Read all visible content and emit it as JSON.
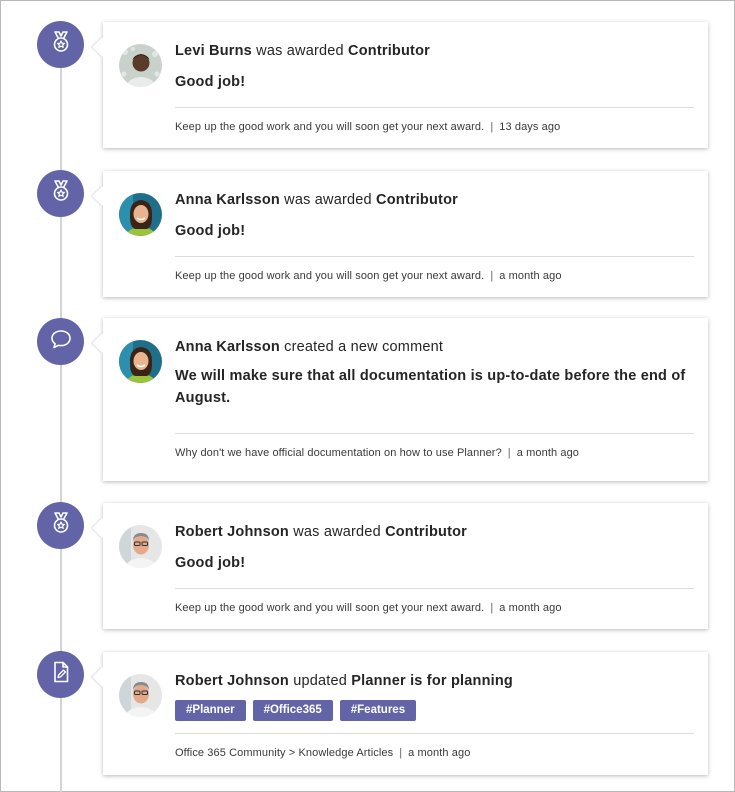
{
  "theme": {
    "accent": "#6264a7",
    "line": "#d4d4d4"
  },
  "items": [
    {
      "icon": "award-medal-icon",
      "avatar": "levi-burns-avatar",
      "user": "Levi Burns",
      "action": "was awarded",
      "object": "Contributor",
      "body": "Good job!",
      "context": "Keep up the good work and you will soon get your next award.",
      "separator": "|",
      "time": "13 days ago"
    },
    {
      "icon": "award-medal-icon",
      "avatar": "anna-karlsson-avatar",
      "user": "Anna Karlsson",
      "action": "was awarded",
      "object": "Contributor",
      "body": "Good job!",
      "context": "Keep up the good work and you will soon get your next award.",
      "separator": "|",
      "time": "a month ago"
    },
    {
      "icon": "comment-icon",
      "avatar": "anna-karlsson-avatar",
      "user": "Anna Karlsson",
      "action": "created a new comment",
      "object": "",
      "body": "We will make sure that all documentation is up-to-date before the end of August.",
      "context": "Why don't we have official documentation on how to use Planner?",
      "separator": "|",
      "time": "a month ago"
    },
    {
      "icon": "award-medal-icon",
      "avatar": "robert-johnson-avatar",
      "user": "Robert Johnson",
      "action": "was awarded",
      "object": "Contributor",
      "body": "Good job!",
      "context": "Keep up the good work and you will soon get your next award.",
      "separator": "|",
      "time": "a month ago"
    },
    {
      "icon": "edit-document-icon",
      "avatar": "robert-johnson-avatar",
      "user": "Robert Johnson",
      "action": "updated",
      "object": "Planner is for planning",
      "tags": [
        "#Planner",
        "#Office365",
        "#Features"
      ],
      "context": "Office 365 Community > Knowledge Articles",
      "separator": "|",
      "time": "a month ago"
    }
  ]
}
